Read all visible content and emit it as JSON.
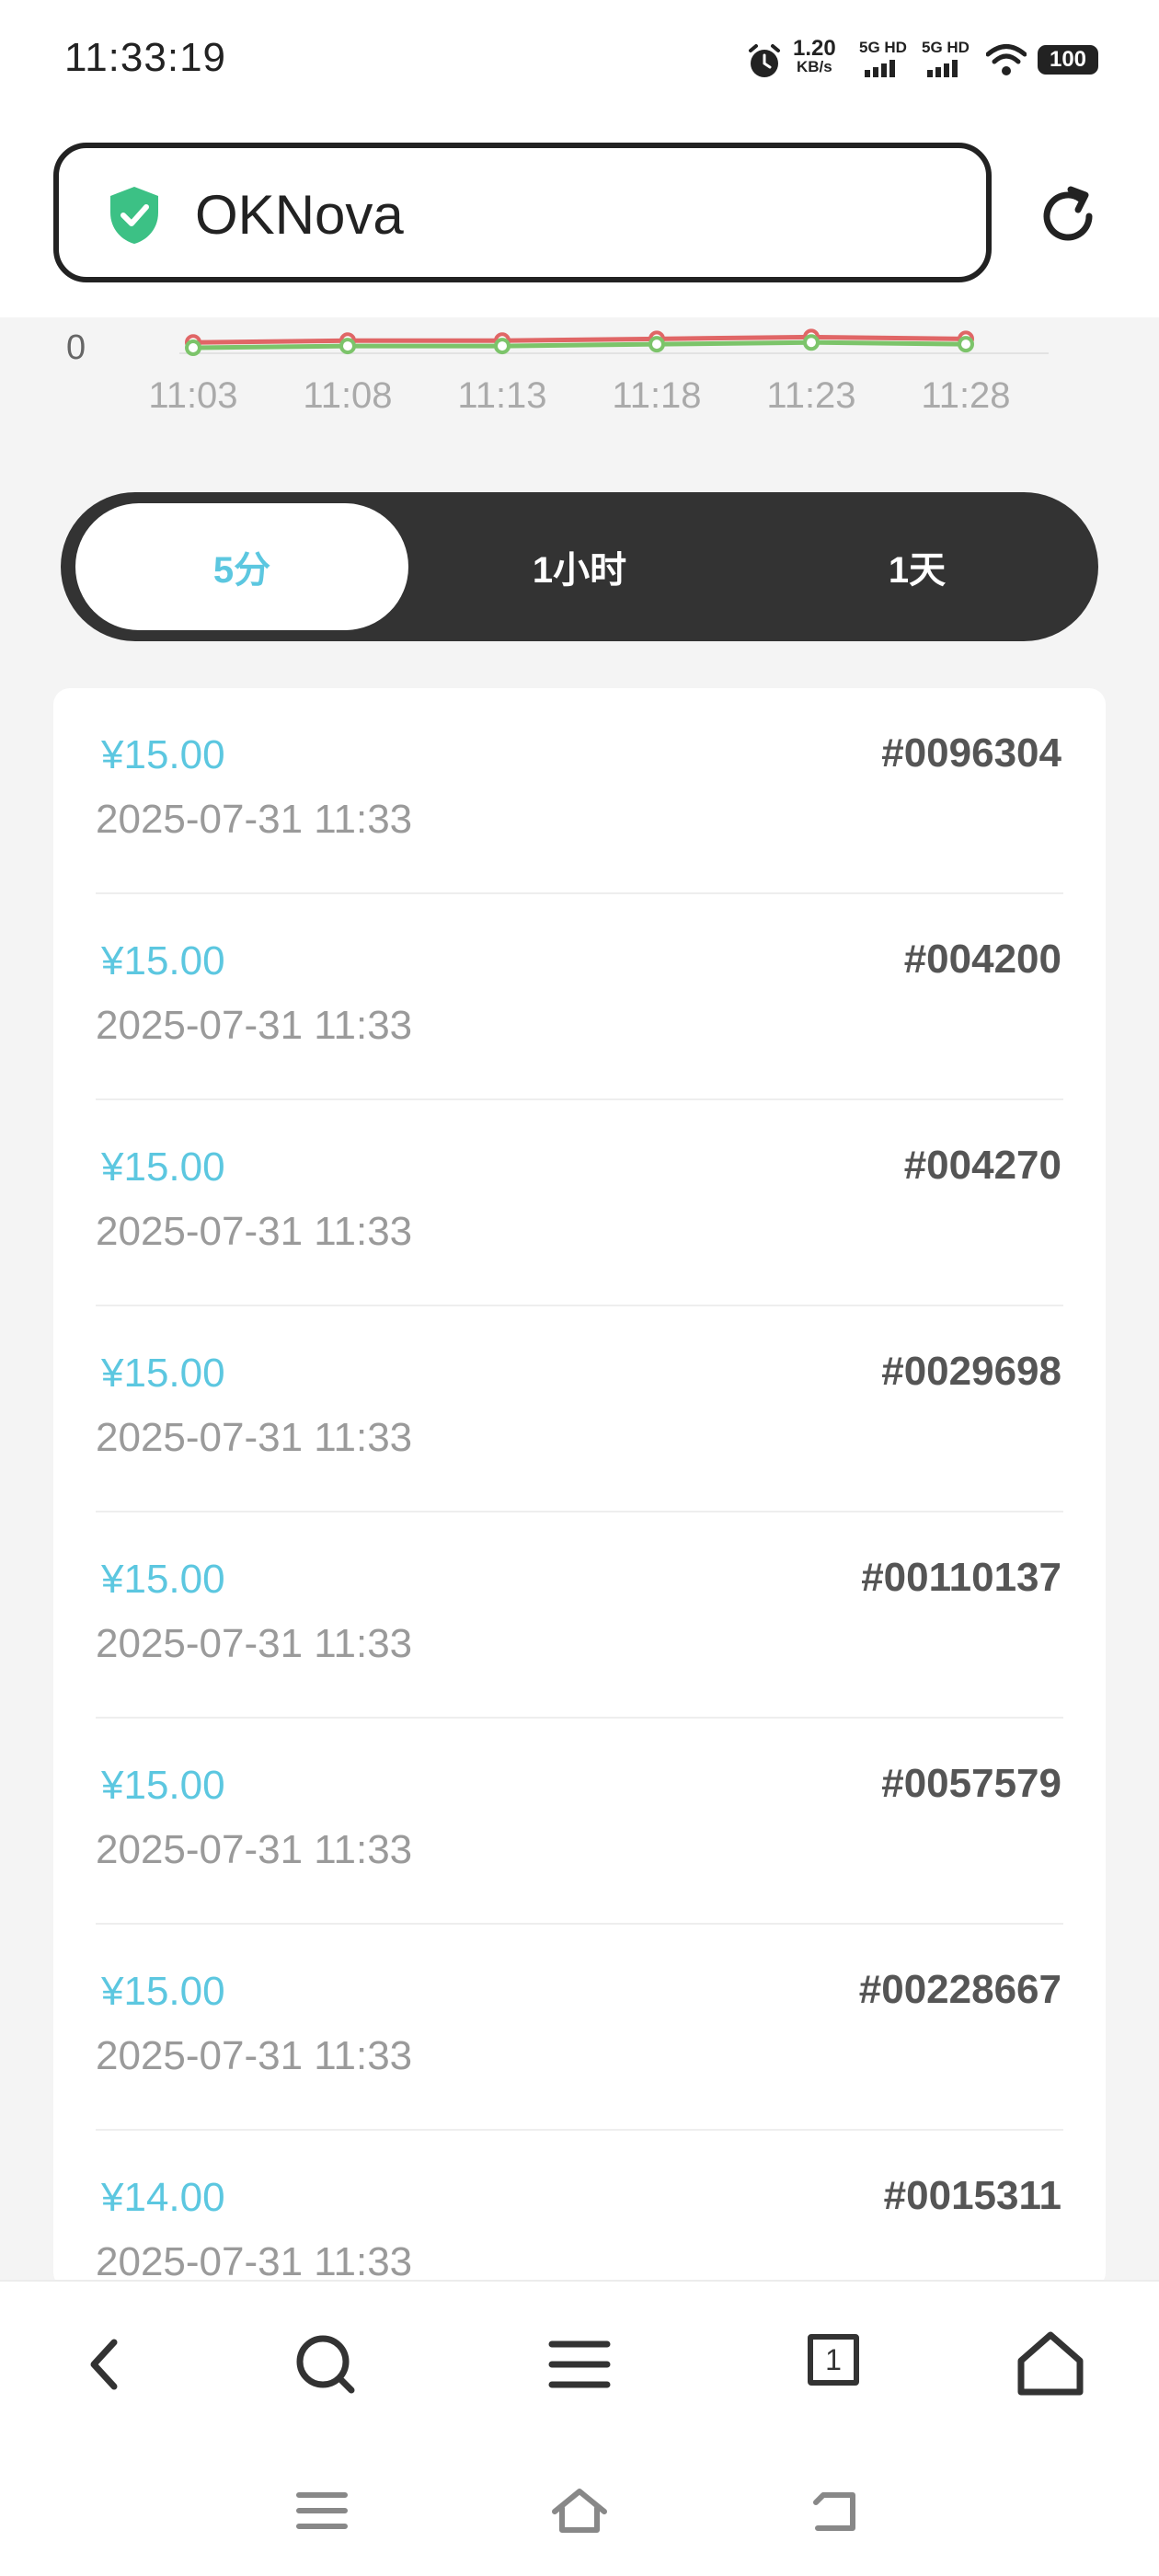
{
  "status_bar": {
    "time": "11:33:19",
    "net_speed_value": "1.20",
    "net_speed_unit": "KB/s",
    "sim1_label": "5G HD",
    "sim2_label": "5G HD",
    "battery": "100"
  },
  "header": {
    "site_name": "OKNova",
    "shield_color": "#3cc185"
  },
  "chart_data": {
    "type": "line",
    "categories": [
      "11:03",
      "11:08",
      "11:13",
      "11:18",
      "11:23",
      "11:28"
    ],
    "y_tick_labels": [
      "0"
    ],
    "ylim": [
      0,
      1
    ],
    "series": [
      {
        "color": "#e06666",
        "values": [
          0.03,
          0.04,
          0.04,
          0.05,
          0.06,
          0.05
        ]
      },
      {
        "color": "#7cc46a",
        "values": [
          0.0,
          0.01,
          0.01,
          0.02,
          0.03,
          0.02
        ]
      }
    ],
    "grid": false
  },
  "segment": {
    "options": [
      "5分",
      "1小时",
      "1天"
    ],
    "active_index": 0,
    "active_color": "#5cc7e0"
  },
  "trades": [
    {
      "price": "¥15.00",
      "date": "2025-07-31 11:33",
      "order": "#0096304"
    },
    {
      "price": "¥15.00",
      "date": "2025-07-31 11:33",
      "order": "#004200"
    },
    {
      "price": "¥15.00",
      "date": "2025-07-31 11:33",
      "order": "#004270"
    },
    {
      "price": "¥15.00",
      "date": "2025-07-31 11:33",
      "order": "#0029698"
    },
    {
      "price": "¥15.00",
      "date": "2025-07-31 11:33",
      "order": "#00110137"
    },
    {
      "price": "¥15.00",
      "date": "2025-07-31 11:33",
      "order": "#0057579"
    },
    {
      "price": "¥15.00",
      "date": "2025-07-31 11:33",
      "order": "#00228667"
    },
    {
      "price": "¥14.00",
      "date": "2025-07-31 11:33",
      "order": "#0015311"
    }
  ],
  "bottom_nav": {
    "tab_count": "1",
    "icons": [
      "back-icon",
      "search-icon",
      "menu-icon",
      "tabs-icon",
      "home-icon"
    ]
  },
  "system_nav": {
    "icons": [
      "recents-icon",
      "home-icon",
      "back-icon"
    ]
  }
}
